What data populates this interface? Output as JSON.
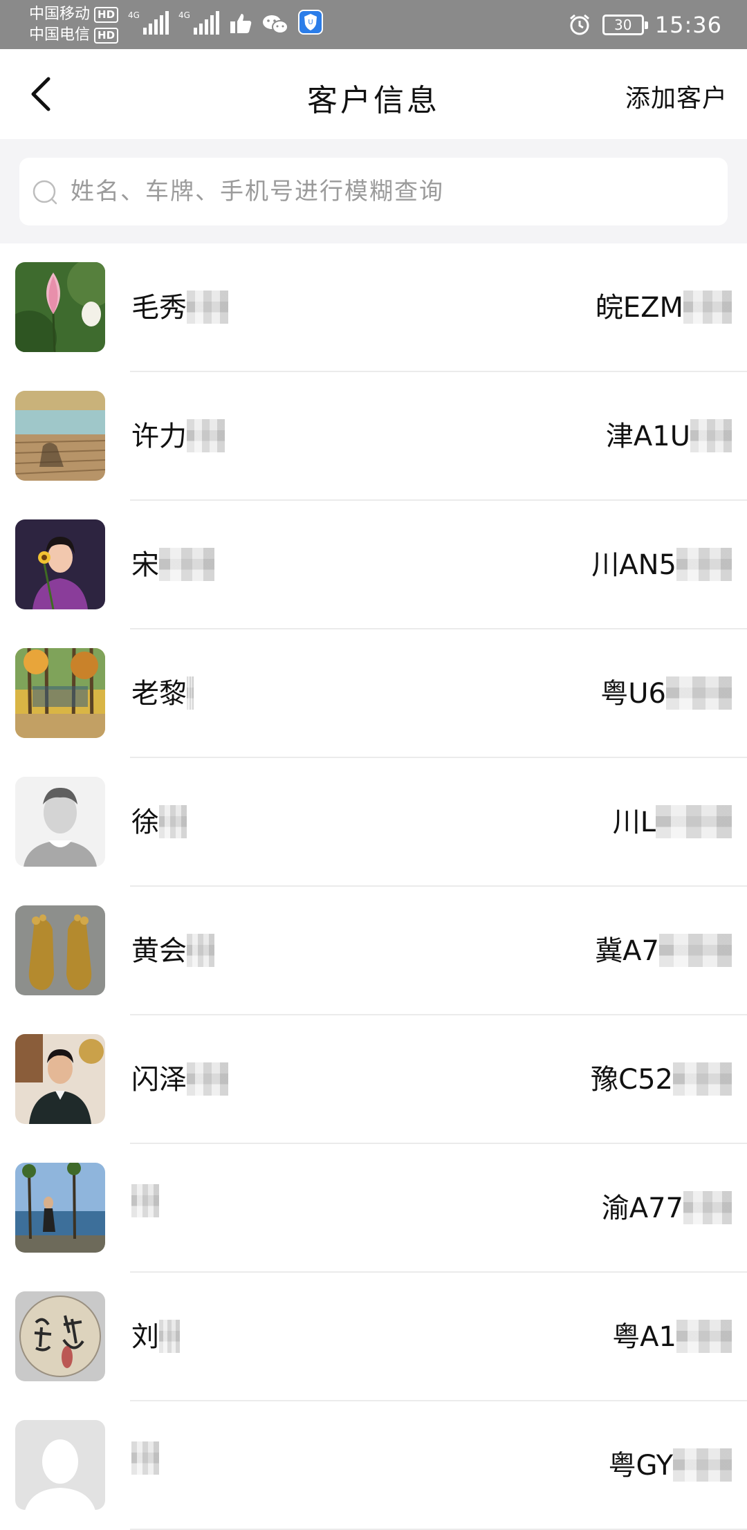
{
  "status_bar": {
    "carrier_1": "中国移动",
    "carrier_2": "中国电信",
    "hd_label": "HD",
    "network_type": "4G",
    "battery_level": "30",
    "time": "15:36",
    "icons": [
      "signal-icon",
      "signal-icon",
      "thumbs-up-icon",
      "wechat-icon",
      "app-shield-icon",
      "alarm-icon",
      "battery-icon"
    ]
  },
  "nav": {
    "title": "客户信息",
    "add_label": "添加客户"
  },
  "search": {
    "placeholder": "姓名、车牌、手机号进行模糊查询"
  },
  "customers": [
    {
      "name": "毛秀",
      "plate": "皖EZM",
      "avatar": "lotus-flower-photo"
    },
    {
      "name": "许力",
      "plate": "津A1U",
      "avatar": "wooden-deck-lake-photo"
    },
    {
      "name": "宋",
      "plate": "川AN5",
      "avatar": "woman-with-sunflower-photo"
    },
    {
      "name": "老黎",
      "plate": "粤U6",
      "avatar": "autumn-trees-photo"
    },
    {
      "name": "徐",
      "plate": "川L",
      "avatar": "default-person-icon"
    },
    {
      "name": "黄会",
      "plate": "冀A7",
      "avatar": "golden-feet-photo"
    },
    {
      "name": "闪泽",
      "plate": "豫C52",
      "avatar": "man-in-suit-photo"
    },
    {
      "name": "",
      "plate": "渝A77",
      "avatar": "woman-by-lake-photo"
    },
    {
      "name": "刘",
      "plate": "粤A1",
      "avatar": "calligraphy-plate-photo"
    },
    {
      "name": "",
      "plate": "粤GY",
      "avatar": "default-person-icon"
    }
  ],
  "colors": {
    "status_bar_bg": "#8a8a8a",
    "search_area_bg": "#f4f4f6",
    "divider": "#ebebeb"
  }
}
